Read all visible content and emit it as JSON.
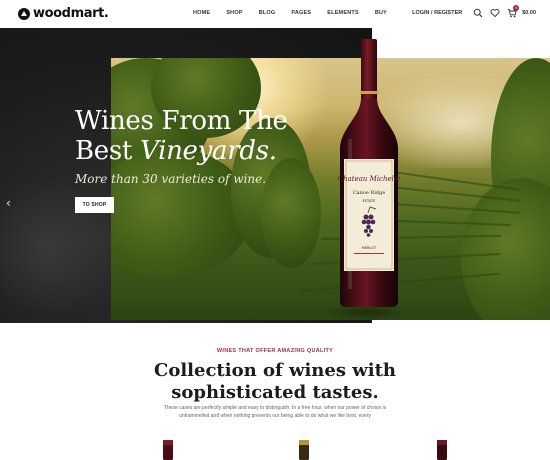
{
  "brand": {
    "name": "woodmart."
  },
  "nav": {
    "items": [
      "HOME",
      "SHOP",
      "BLOG",
      "PAGES",
      "ELEMENTS",
      "BUY"
    ]
  },
  "header": {
    "login_label": "LOGIN / REGISTER",
    "cart_count": "0",
    "cart_total": "$0.00",
    "icons": [
      "search-icon",
      "heart-icon",
      "cart-icon"
    ]
  },
  "hero": {
    "headline_line1": "Wines From The",
    "headline_line2_plain": "Best ",
    "headline_line2_italic": "Vineyards.",
    "subline": "More than 30 varieties of wine.",
    "button_label": "TO SHOP",
    "prev_icon": "chevron-left-icon",
    "bottle_label": {
      "brand": "Chateau Michelle",
      "sub": "Canoe Ridge",
      "estate": "ESTATE",
      "variety": "MERLOT"
    }
  },
  "section": {
    "kicker": "WINES THAT OFFER AMAZING QUALITY",
    "title_line1": "Collection of wines with",
    "title_line2": "sophisticated tastes.",
    "text_line1": "These cases are perfectly simple and easy to distinguish. In a free hour, when our power of choice is",
    "text_line2": "untrammelled and when nothing prevents our being able to do what we like best, every"
  },
  "colors": {
    "accent": "#a33045",
    "hero_dark": "#1c1c1c",
    "wine": "#5a0f1c"
  }
}
